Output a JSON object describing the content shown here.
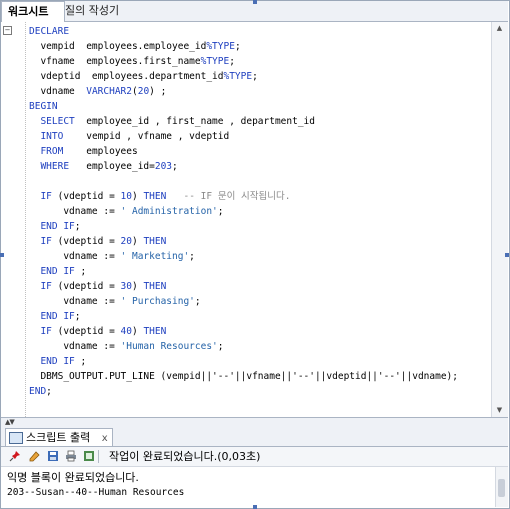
{
  "tabs": [
    {
      "label": "워크시트"
    },
    {
      "label": "질의 작성기"
    }
  ],
  "code_lines": [
    {
      "indent": "",
      "parts": [
        [
          "kw",
          "DECLARE"
        ]
      ]
    },
    {
      "indent": "  ",
      "parts": [
        [
          "",
          "vempid  employees.employee_id"
        ],
        [
          "kw",
          "%TYPE"
        ],
        [
          "",
          ";"
        ]
      ]
    },
    {
      "indent": "  ",
      "parts": [
        [
          "",
          "vfname  employees.first_name"
        ],
        [
          "kw",
          "%TYPE"
        ],
        [
          "",
          ";"
        ]
      ]
    },
    {
      "indent": "  ",
      "parts": [
        [
          "",
          "vdeptid  employees.department_id"
        ],
        [
          "kw",
          "%TYPE"
        ],
        [
          "",
          ";"
        ]
      ]
    },
    {
      "indent": "  ",
      "parts": [
        [
          "",
          "vdname  "
        ],
        [
          "kw",
          "VARCHAR2"
        ],
        [
          "",
          "("
        ],
        [
          "num",
          "20"
        ],
        [
          "",
          ") ;"
        ]
      ]
    },
    {
      "indent": "",
      "parts": [
        [
          "kw",
          "BEGIN"
        ]
      ]
    },
    {
      "indent": "  ",
      "parts": [
        [
          "kw",
          "SELECT"
        ],
        [
          "",
          "  employee_id , first_name , department_id"
        ]
      ]
    },
    {
      "indent": "  ",
      "parts": [
        [
          "kw",
          "INTO"
        ],
        [
          "",
          "    vempid , vfname , vdeptid"
        ]
      ]
    },
    {
      "indent": "  ",
      "parts": [
        [
          "kw",
          "FROM"
        ],
        [
          "",
          "    employees"
        ]
      ]
    },
    {
      "indent": "  ",
      "parts": [
        [
          "kw",
          "WHERE"
        ],
        [
          "",
          "   employee_id="
        ],
        [
          "num",
          "203"
        ],
        [
          "",
          ";"
        ]
      ]
    },
    {
      "indent": "",
      "parts": []
    },
    {
      "indent": "  ",
      "parts": [
        [
          "kw",
          "IF"
        ],
        [
          "",
          " (vdeptid = "
        ],
        [
          "num",
          "10"
        ],
        [
          "",
          ") "
        ],
        [
          "kw",
          "THEN"
        ],
        [
          "",
          "   "
        ],
        [
          "cmt",
          "-- IF 문이 시작됩니다."
        ]
      ]
    },
    {
      "indent": "      ",
      "parts": [
        [
          "",
          "vdname := "
        ],
        [
          "str",
          "' Administration'"
        ],
        [
          "",
          ";"
        ]
      ]
    },
    {
      "indent": "  ",
      "parts": [
        [
          "kw",
          "END IF"
        ],
        [
          "",
          ";"
        ]
      ]
    },
    {
      "indent": "  ",
      "parts": [
        [
          "kw",
          "IF"
        ],
        [
          "",
          " (vdeptid = "
        ],
        [
          "num",
          "20"
        ],
        [
          "",
          ") "
        ],
        [
          "kw",
          "THEN"
        ]
      ]
    },
    {
      "indent": "      ",
      "parts": [
        [
          "",
          "vdname := "
        ],
        [
          "str",
          "' Marketing'"
        ],
        [
          "",
          ";"
        ]
      ]
    },
    {
      "indent": "  ",
      "parts": [
        [
          "kw",
          "END IF"
        ],
        [
          "",
          " ;"
        ]
      ]
    },
    {
      "indent": "  ",
      "parts": [
        [
          "kw",
          "IF"
        ],
        [
          "",
          " (vdeptid = "
        ],
        [
          "num",
          "30"
        ],
        [
          "",
          ") "
        ],
        [
          "kw",
          "THEN"
        ]
      ]
    },
    {
      "indent": "      ",
      "parts": [
        [
          "",
          "vdname := "
        ],
        [
          "str",
          "' Purchasing'"
        ],
        [
          "",
          ";"
        ]
      ]
    },
    {
      "indent": "  ",
      "parts": [
        [
          "kw",
          "END IF"
        ],
        [
          "",
          ";"
        ]
      ]
    },
    {
      "indent": "  ",
      "parts": [
        [
          "kw",
          "IF"
        ],
        [
          "",
          " (vdeptid = "
        ],
        [
          "num",
          "40"
        ],
        [
          "",
          ") "
        ],
        [
          "kw",
          "THEN"
        ]
      ]
    },
    {
      "indent": "      ",
      "parts": [
        [
          "",
          "vdname := "
        ],
        [
          "str",
          "'Human Resources'"
        ],
        [
          "",
          ";"
        ]
      ]
    },
    {
      "indent": "  ",
      "parts": [
        [
          "kw",
          "END IF"
        ],
        [
          "",
          " ;"
        ]
      ]
    },
    {
      "indent": "  ",
      "parts": [
        [
          "",
          "DBMS_OUTPUT.PUT_LINE (vempid||'--'||vfname||'--'||vdeptid||'--'||vdname);"
        ]
      ]
    },
    {
      "indent": "",
      "parts": [
        [
          "kw",
          "END"
        ],
        [
          "",
          ";"
        ]
      ]
    }
  ],
  "output_panel": {
    "tab_label": "스크립트 출력",
    "close_label": "x",
    "status_text": "작업이 완료되었습니다.(0,03초)",
    "message": "익명 블록이 완료되었습니다.",
    "result_line": "203--Susan--40--Human Resources"
  },
  "icons": {
    "pin": "pin-icon",
    "eraser": "eraser-icon",
    "save": "save-icon",
    "print": "print-icon",
    "export": "export-icon"
  },
  "colors": {
    "keyword": "#1e3fbf",
    "string": "#2563a8",
    "comment": "#8a8a8a"
  }
}
